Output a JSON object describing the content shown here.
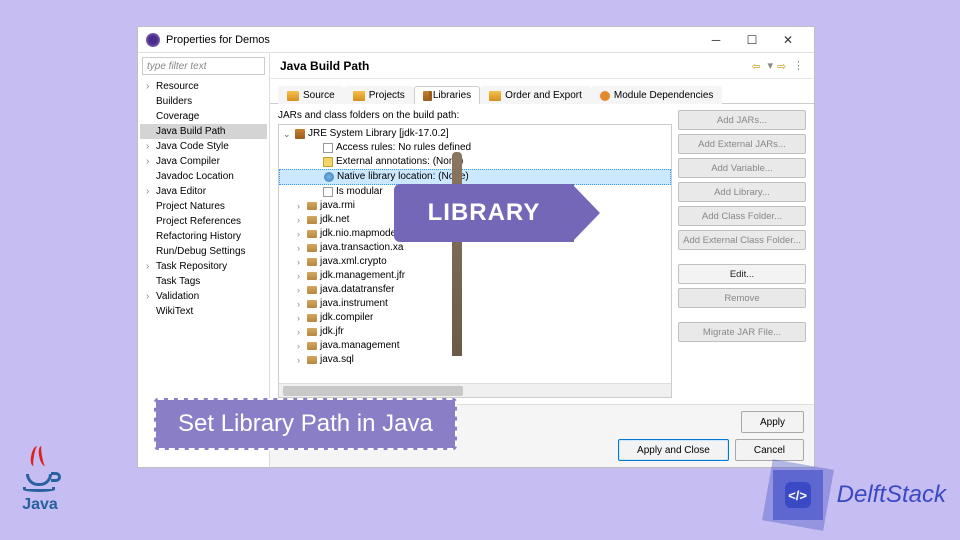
{
  "overlay": {
    "sign_text": "LIBRARY",
    "title_text": "Set Library Path in Java",
    "java_label": "Java",
    "delft_label": "DelftStack",
    "delft_core": "</>"
  },
  "dialog": {
    "title": "Properties for Demos",
    "filter_placeholder": "type filter text",
    "nav": [
      {
        "label": "Resource",
        "children": true
      },
      {
        "label": "Builders"
      },
      {
        "label": "Coverage"
      },
      {
        "label": "Java Build Path",
        "selected": true
      },
      {
        "label": "Java Code Style",
        "children": true
      },
      {
        "label": "Java Compiler",
        "children": true
      },
      {
        "label": "Javadoc Location"
      },
      {
        "label": "Java Editor",
        "children": true
      },
      {
        "label": "Project Natures"
      },
      {
        "label": "Project References"
      },
      {
        "label": "Refactoring History"
      },
      {
        "label": "Run/Debug Settings"
      },
      {
        "label": "Task Repository",
        "children": true
      },
      {
        "label": "Task Tags"
      },
      {
        "label": "Validation",
        "children": true
      },
      {
        "label": "WikiText"
      }
    ],
    "main_title": "Java Build Path",
    "tabs": [
      {
        "label": "Source",
        "icon": "ic-source"
      },
      {
        "label": "Projects",
        "icon": "ic-projects"
      },
      {
        "label": "Libraries",
        "icon": "ic-libraries",
        "active": true
      },
      {
        "label": "Order and Export",
        "icon": "ic-order"
      },
      {
        "label": "Module Dependencies",
        "icon": "ic-module"
      }
    ],
    "content_label": "JARs and class folders on the build path:",
    "tree": {
      "root": "JRE System Library [jdk-17.0.2]",
      "props": [
        {
          "label": "Access rules: No rules defined",
          "icon": "file-icon"
        },
        {
          "label": "External annotations: (None)",
          "icon": "note-icon"
        },
        {
          "label": "Native library location: (None)",
          "icon": "globe-icon",
          "selected": true
        },
        {
          "label": "Is modular",
          "icon": "file-icon"
        }
      ],
      "packages": [
        "java.rmi",
        "jdk.net",
        "jdk.nio.mapmode",
        "java.transaction.xa",
        "java.xml.crypto",
        "jdk.management.jfr",
        "java.datatransfer",
        "java.instrument",
        "jdk.compiler",
        "jdk.jfr",
        "java.management",
        "java.sql"
      ]
    },
    "side_buttons": [
      {
        "label": "Add JARs...",
        "enabled": false
      },
      {
        "label": "Add External JARs...",
        "enabled": false
      },
      {
        "label": "Add Variable...",
        "enabled": false
      },
      {
        "label": "Add Library...",
        "enabled": false
      },
      {
        "label": "Add Class Folder...",
        "enabled": false
      },
      {
        "label": "Add External Class Folder...",
        "enabled": false
      },
      {
        "label": "Edit...",
        "enabled": true,
        "spacer_before": true
      },
      {
        "label": "Remove",
        "enabled": false
      },
      {
        "label": "Migrate JAR File...",
        "enabled": false,
        "spacer_before": true
      }
    ],
    "footer": {
      "apply": "Apply",
      "apply_close": "Apply and Close",
      "cancel": "Cancel"
    }
  }
}
